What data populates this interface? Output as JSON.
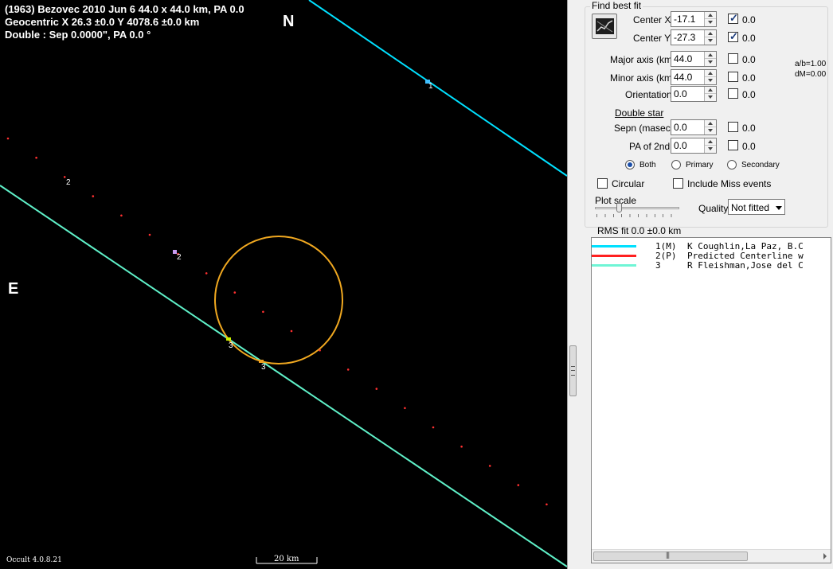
{
  "plot": {
    "header_line1": "(1963) Bezovec  2010 Jun 6   44.0 x 44.0 km,  PA 0.0",
    "header_line2": "Geocentric  X  26.3 ±0.0   Y 4078.6 ±0.0 km",
    "header_line3": "Double : Sep  0.0000\",  PA 0.0 °",
    "north_label": "N",
    "east_label": "E",
    "version": "Occult 4.0.8.21",
    "scale_label": "20 km",
    "chord_labels": {
      "line1_point": "1",
      "line3_point_a": "3",
      "line3_point_b": "3",
      "predicted_a": "2",
      "predicted_b": "2"
    },
    "colors": {
      "background": "#000000",
      "chord_1": "#00e0ff",
      "chord_3": "#5ff0c8",
      "asteroid_profile": "#f0a820",
      "predicted_centerline": "#ff3030",
      "text": "#ffffff"
    }
  },
  "panel": {
    "group_title": "Find best fit",
    "fit_button_icon": "fit-graph-icon",
    "center_x_label": "Center X",
    "center_x_value": "-17.1",
    "center_x_check_value": "0.0",
    "center_y_label": "Center Y",
    "center_y_value": "-27.3",
    "center_y_check_value": "0.0",
    "major_label": "Major axis (km)",
    "major_value": "44.0",
    "major_check_value": "0.0",
    "minor_label": "Minor axis (km)",
    "minor_value": "44.0",
    "minor_check_value": "0.0",
    "orientation_label": "Orientation",
    "orientation_value": "0.0",
    "orientation_check_value": "0.0",
    "ab_ratio": "a/b=1.00",
    "dm": "dM=0.00",
    "double_star_label": "Double star",
    "sepn_label": "Sepn (masec)",
    "sepn_value": "0.0",
    "sepn_check_value": "0.0",
    "pa2_label": "PA of 2nd",
    "pa2_value": "0.0",
    "pa2_check_value": "0.0",
    "radio_both": "Both",
    "radio_primary": "Primary",
    "radio_secondary": "Secondary",
    "circular_label": "Circular",
    "include_miss_label": "Include Miss events",
    "plot_scale_label": "Plot scale",
    "plot_scale_level": 0.27,
    "quality_label": "Quality",
    "quality_value": "Not fitted",
    "rms_fit": "RMS fit 0.0 ±0.0 km",
    "checks": {
      "center_x": true,
      "center_y": true,
      "major": false,
      "minor": false,
      "orientation": false,
      "sepn": false,
      "pa2": false,
      "circular": false,
      "include_miss": false
    },
    "selected_radio": "Both"
  },
  "observers": [
    {
      "code": "1(M)",
      "name": "K Coughlin,La Paz, B.C",
      "color": "#00e0ff"
    },
    {
      "code": "2(P)",
      "name": "Predicted Centerline w",
      "color": "#ff2020"
    },
    {
      "code": "3",
      "name": "R Fleishman,Jose del C",
      "color": "#6ff5d5"
    }
  ]
}
